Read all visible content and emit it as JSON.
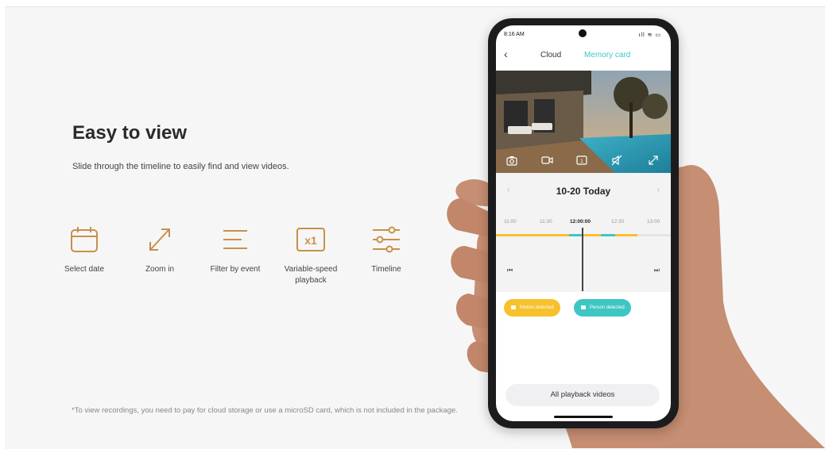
{
  "hero": {
    "title": "Easy to view",
    "subtitle": "Slide through the timeline to easily find and view videos."
  },
  "features": [
    {
      "icon": "calendar-icon",
      "label": "Select date"
    },
    {
      "icon": "zoom-in-icon",
      "label": "Zoom in"
    },
    {
      "icon": "filter-icon",
      "label": "Filter by event"
    },
    {
      "icon": "speed-x1-icon",
      "label": "Variable-speed playback"
    },
    {
      "icon": "timeline-sliders-icon",
      "label": "Timeline"
    }
  ],
  "footnote": "*To view recordings, you need to pay for cloud storage or use a microSD card, which is not included in the package.",
  "phone": {
    "status_time": "8:16 AM",
    "status_icons": "ıll ≋ ▭",
    "nav": {
      "back": "‹",
      "tab_cloud": "Cloud",
      "tab_memory": "Memory card"
    },
    "date_label": "10-20 Today",
    "prev_arrow": "‹",
    "next_arrow": "›",
    "ticks": [
      "11:00",
      "11:30",
      "12:00:00",
      "12:30",
      "13:00"
    ],
    "transport": {
      "start": "⏮",
      "end": "⏭"
    },
    "chips": {
      "motion": "Motion detected",
      "person": "Person detected"
    },
    "all_videos_label": "All playback videos"
  },
  "colors": {
    "accent_gold": "#c7914a",
    "accent_teal": "#3cc6c4",
    "motion_yellow": "#f6c12d",
    "person_teal": "#3ec6c3"
  }
}
